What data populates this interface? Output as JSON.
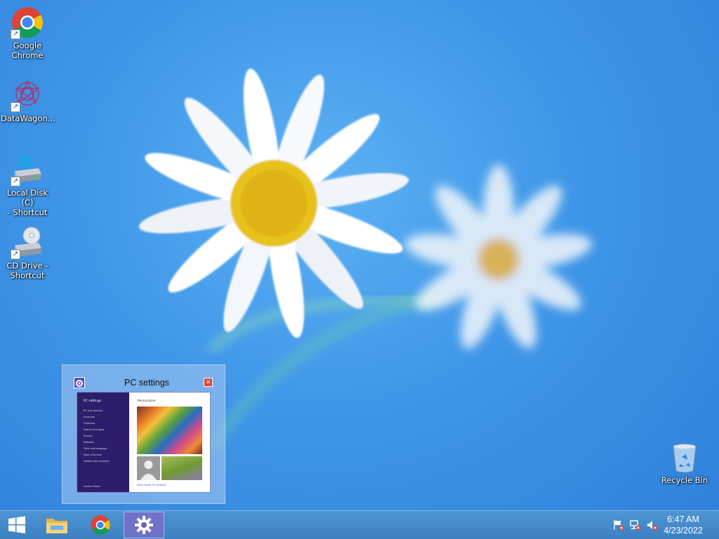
{
  "desktop": {
    "icons": [
      {
        "label": "Google\nChrome",
        "icon": "chrome-icon"
      },
      {
        "label": "DataWagon...",
        "icon": "datawagon-icon"
      },
      {
        "label": "Local Disk (C)\n- Shortcut",
        "icon": "hard-drive-icon"
      },
      {
        "label": "CD Drive -\nShortcut",
        "icon": "cd-drive-icon"
      },
      {
        "label": "Recycle Bin",
        "icon": "recycle-bin-icon"
      }
    ]
  },
  "preview": {
    "title": "PC settings",
    "close": "✕",
    "mini": {
      "sidebar_title": "PC settings",
      "sidebar_items": [
        "PC and devices",
        "Accounts",
        "OneDrive",
        "Search and apps",
        "Privacy",
        "Network",
        "Time and language",
        "Ease of Access",
        "Update and recovery"
      ],
      "sidebar_footer": "Control Panel",
      "header": "Personalize",
      "link": "View recent PC settings"
    }
  },
  "taskbar": {
    "items": [
      {
        "name": "start-button",
        "icon": "windows-logo-icon"
      },
      {
        "name": "file-explorer",
        "icon": "folder-icon"
      },
      {
        "name": "chrome",
        "icon": "chrome-icon"
      },
      {
        "name": "pc-settings",
        "icon": "gear-icon",
        "active": true
      }
    ],
    "tray": {
      "icons": [
        "action-center-flag-icon",
        "network-icon",
        "volume-muted-icon"
      ]
    },
    "clock": {
      "time": "6:47 AM",
      "date": "4/23/2022"
    }
  },
  "colors": {
    "taskbar": "#3d80c2",
    "active_task": "#6b5fc4",
    "close_red": "#d9453a",
    "mini_sidebar": "#2d1e6b"
  }
}
